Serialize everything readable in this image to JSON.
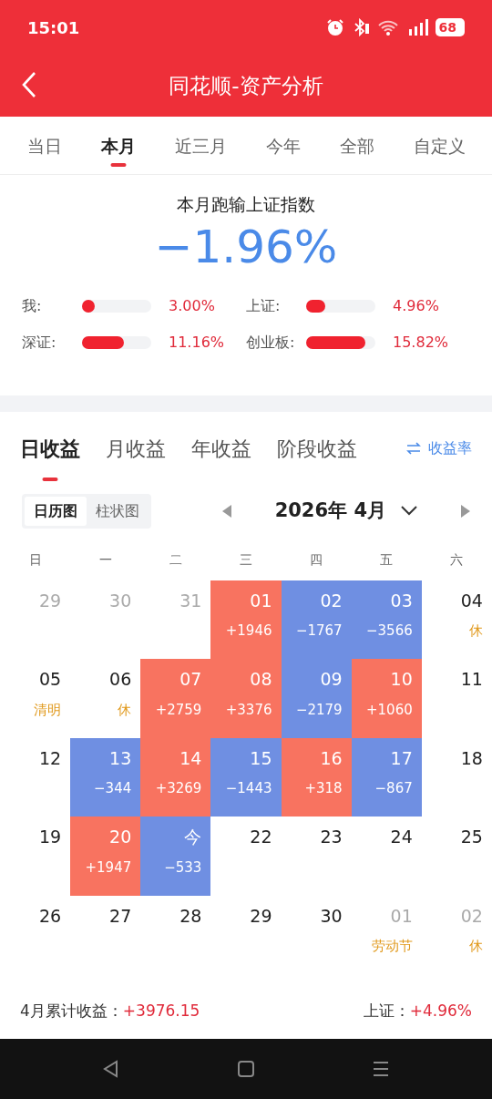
{
  "status_bar": {
    "time": "15:01",
    "battery": "68"
  },
  "header": {
    "title": "同花顺-资产分析"
  },
  "period_tabs": [
    {
      "label": "当日",
      "selected": false
    },
    {
      "label": "本月",
      "selected": true
    },
    {
      "label": "近三月",
      "selected": false
    },
    {
      "label": "今年",
      "selected": false
    },
    {
      "label": "全部",
      "selected": false
    },
    {
      "label": "自定义",
      "selected": false
    }
  ],
  "summary": {
    "title": "本月跑输上证指数",
    "value": "−1.96%",
    "comparisons": [
      {
        "label": "我:",
        "level": 0.18,
        "reading": "3.00%"
      },
      {
        "label": "上证:",
        "level": 0.28,
        "reading": "4.96%"
      },
      {
        "label": "深证:",
        "level": 0.6,
        "reading": "11.16%"
      },
      {
        "label": "创业板:",
        "level": 0.86,
        "reading": "15.82%"
      }
    ]
  },
  "profit_tabs": [
    {
      "label": "日收益",
      "selected": true
    },
    {
      "label": "月收益",
      "selected": false
    },
    {
      "label": "年收益",
      "selected": false
    },
    {
      "label": "阶段收益",
      "selected": false
    }
  ],
  "switch_link": "收益率",
  "view_toggle": [
    {
      "label": "日历图",
      "selected": true
    },
    {
      "label": "柱状图",
      "selected": false
    }
  ],
  "month": "2026年 4月",
  "weekdays": [
    "日",
    "一",
    "二",
    "三",
    "四",
    "五",
    "六"
  ],
  "calendar": [
    {
      "day": "29",
      "kind": "outside"
    },
    {
      "day": "30",
      "kind": "outside"
    },
    {
      "day": "31",
      "kind": "outside"
    },
    {
      "day": "01",
      "kind": "gain",
      "value": "+1946"
    },
    {
      "day": "02",
      "kind": "loss",
      "value": "−1767"
    },
    {
      "day": "03",
      "kind": "loss",
      "value": "−3566"
    },
    {
      "day": "04",
      "kind": "plain",
      "note": "休"
    },
    {
      "day": "05",
      "kind": "plain",
      "note": "清明"
    },
    {
      "day": "06",
      "kind": "plain",
      "note": "休"
    },
    {
      "day": "07",
      "kind": "gain",
      "value": "+2759"
    },
    {
      "day": "08",
      "kind": "gain",
      "value": "+3376"
    },
    {
      "day": "09",
      "kind": "loss",
      "value": "−2179"
    },
    {
      "day": "10",
      "kind": "gain",
      "value": "+1060"
    },
    {
      "day": "11",
      "kind": "plain"
    },
    {
      "day": "12",
      "kind": "plain"
    },
    {
      "day": "13",
      "kind": "loss",
      "value": "−344"
    },
    {
      "day": "14",
      "kind": "gain",
      "value": "+3269"
    },
    {
      "day": "15",
      "kind": "loss",
      "value": "−1443"
    },
    {
      "day": "16",
      "kind": "gain",
      "value": "+318"
    },
    {
      "day": "17",
      "kind": "loss",
      "value": "−867"
    },
    {
      "day": "18",
      "kind": "plain"
    },
    {
      "day": "19",
      "kind": "plain"
    },
    {
      "day": "20",
      "kind": "gain",
      "value": "+1947"
    },
    {
      "day": "今",
      "kind": "loss",
      "value": "−533"
    },
    {
      "day": "22",
      "kind": "plain"
    },
    {
      "day": "23",
      "kind": "plain"
    },
    {
      "day": "24",
      "kind": "plain"
    },
    {
      "day": "25",
      "kind": "plain"
    },
    {
      "day": "26",
      "kind": "plain"
    },
    {
      "day": "27",
      "kind": "plain"
    },
    {
      "day": "28",
      "kind": "plain"
    },
    {
      "day": "29",
      "kind": "plain"
    },
    {
      "day": "30",
      "kind": "plain"
    },
    {
      "day": "01",
      "kind": "outside",
      "note": "劳动节"
    },
    {
      "day": "02",
      "kind": "outside",
      "note": "休"
    }
  ],
  "footer": {
    "total_label": "4月累计收益：",
    "total_value": "+3976.15",
    "index_label": "上证：",
    "index_value": "+4.96%"
  }
}
